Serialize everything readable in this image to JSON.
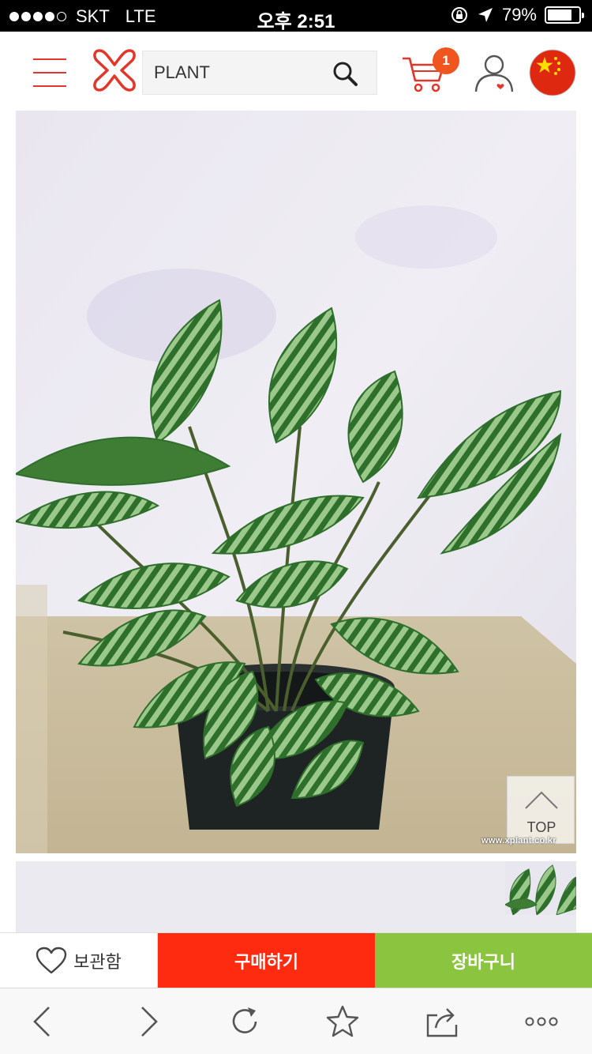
{
  "status_bar": {
    "carrier": "SKT",
    "network": "LTE",
    "time": "오후 2:51",
    "battery_percent": "79%",
    "battery_level": 0.79
  },
  "header": {
    "search": {
      "value": "PLANT"
    },
    "cart_count": "1",
    "accent_color": "#e2362a"
  },
  "product": {
    "top_label": "TOP",
    "watermark": "www.xplant.co.kr"
  },
  "actions": {
    "wish_label": "보관함",
    "buy_label": "구매하기",
    "cart_label": "장바구니",
    "buy_color": "#ff2b10",
    "cart_color": "#8bc53f"
  },
  "browser_toolbar": {
    "icons": [
      "back-icon",
      "forward-icon",
      "reload-icon",
      "bookmark-icon",
      "share-icon",
      "more-icon"
    ]
  }
}
